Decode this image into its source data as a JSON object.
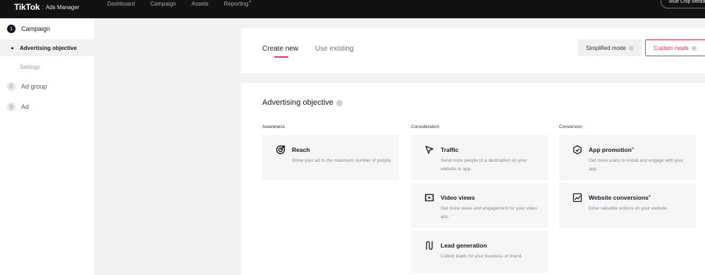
{
  "topbar": {
    "logo": {
      "brand": "TikTok",
      "separator": ":",
      "product": "Ads Manager"
    },
    "nav": [
      {
        "label": "Dashboard"
      },
      {
        "label": "Campaign"
      },
      {
        "label": "Assets"
      },
      {
        "label": "Reporting"
      }
    ],
    "account": "Blue Chip Media"
  },
  "sidebar": {
    "steps": [
      {
        "number": "1",
        "label": "Campaign"
      },
      {
        "number": "2",
        "label": "Ad group"
      },
      {
        "number": "3",
        "label": "Ad"
      }
    ],
    "subitems": [
      {
        "label": "Advertising objective"
      },
      {
        "label": "Settings"
      }
    ]
  },
  "tabs": {
    "create_new": "Create new",
    "use_existing": "Use existing"
  },
  "modes": {
    "simplified": "Simplified mode",
    "custom": "Custom mode"
  },
  "objective": {
    "title": "Advertising objective",
    "columns": [
      {
        "label": "Awareness",
        "tiles": [
          {
            "name": "Reach",
            "desc": "Show your ad to the maximum number of people.",
            "icon": "reach-icon"
          }
        ]
      },
      {
        "label": "Consideration",
        "tiles": [
          {
            "name": "Traffic",
            "desc": "Send more people to a destination on your website or app.",
            "icon": "cursor-icon"
          },
          {
            "name": "Video views",
            "desc": "Get more views and engagement for your video ads.",
            "icon": "video-icon"
          },
          {
            "name": "Lead generation",
            "desc": "Collect leads for your business or brand.",
            "icon": "lead-icon"
          }
        ]
      },
      {
        "label": "Conversion",
        "tiles": [
          {
            "name": "App promotion",
            "desc": "Get more users to install and engage with your app.",
            "icon": "app-icon",
            "marker": "*"
          },
          {
            "name": "Website conversions",
            "desc": "Drive valuable actions on your website.",
            "icon": "chart-icon",
            "marker": "*"
          }
        ]
      }
    ]
  },
  "colors": {
    "accent": "#fe2c55",
    "topbar": "#121212",
    "background": "#f2f2f3"
  }
}
